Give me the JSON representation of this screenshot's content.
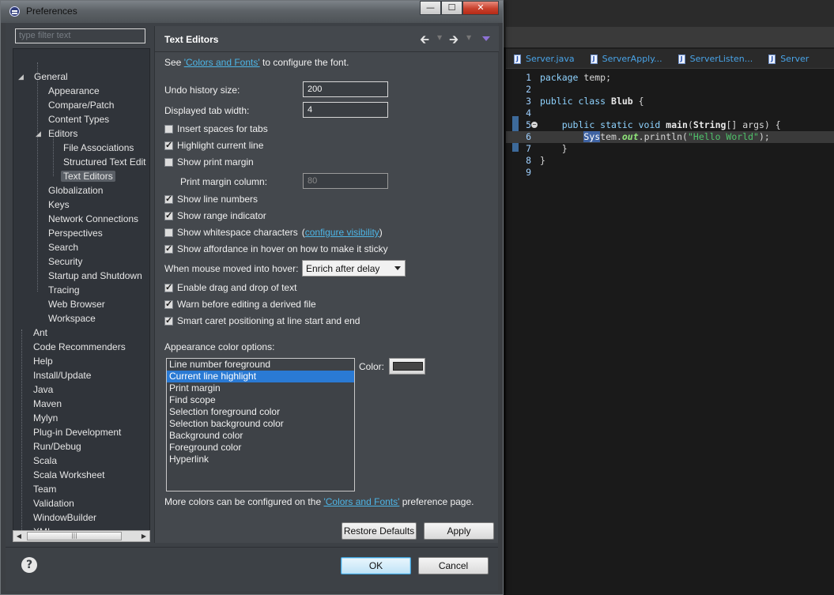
{
  "window": {
    "title": "Preferences",
    "minimize": "—",
    "maximize": "☐",
    "close": "✕"
  },
  "filter": {
    "placeholder": "type filter text"
  },
  "tree": [
    {
      "label": "General",
      "expanded": true
    },
    {
      "label": "Appearance"
    },
    {
      "label": "Compare/Patch"
    },
    {
      "label": "Content Types"
    },
    {
      "label": "Editors",
      "expanded": true
    },
    {
      "label": "File Associations"
    },
    {
      "label": "Structured Text Edit"
    },
    {
      "label": "Text Editors",
      "selected": true
    },
    {
      "label": "Globalization"
    },
    {
      "label": "Keys"
    },
    {
      "label": "Network Connections"
    },
    {
      "label": "Perspectives"
    },
    {
      "label": "Search"
    },
    {
      "label": "Security"
    },
    {
      "label": "Startup and Shutdown"
    },
    {
      "label": "Tracing"
    },
    {
      "label": "Web Browser"
    },
    {
      "label": "Workspace"
    },
    {
      "label": "Ant"
    },
    {
      "label": "Code Recommenders"
    },
    {
      "label": "Help"
    },
    {
      "label": "Install/Update"
    },
    {
      "label": "Java"
    },
    {
      "label": "Maven"
    },
    {
      "label": "Mylyn"
    },
    {
      "label": "Plug-in Development"
    },
    {
      "label": "Run/Debug"
    },
    {
      "label": "Scala"
    },
    {
      "label": "Scala Worksheet"
    },
    {
      "label": "Team"
    },
    {
      "label": "Validation"
    },
    {
      "label": "WindowBuilder"
    },
    {
      "label": "XML"
    }
  ],
  "page": {
    "title": "Text Editors",
    "see_prefix": "See ",
    "see_link": "'Colors and Fonts'",
    "see_suffix": " to configure the font.",
    "undo_label": "Undo history size:",
    "undo_value": "200",
    "tab_label": "Displayed tab width:",
    "tab_value": "4",
    "insert_spaces": {
      "label": "Insert spaces for tabs",
      "checked": false
    },
    "highlight_line": {
      "label": "Highlight current line",
      "checked": true
    },
    "print_margin": {
      "label": "Show print margin",
      "checked": false
    },
    "print_margin_col_label": "Print margin column:",
    "print_margin_col_value": "80",
    "line_numbers": {
      "label": "Show line numbers",
      "checked": true
    },
    "range_indicator": {
      "label": "Show range indicator",
      "checked": true
    },
    "whitespace": {
      "label": "Show whitespace characters",
      "checked": false,
      "paren_open": "(",
      "link": "configure visibility",
      "paren_close": ")"
    },
    "affordance": {
      "label": "Show affordance in hover on how to make it sticky",
      "checked": true
    },
    "hover_label": "When mouse moved into hover:",
    "hover_value": "Enrich after delay",
    "drag_drop": {
      "label": "Enable drag and drop of text",
      "checked": true
    },
    "warn_derived": {
      "label": "Warn before editing a derived file",
      "checked": true
    },
    "smart_caret": {
      "label": "Smart caret positioning at line start and end",
      "checked": true
    },
    "appearance_label": "Appearance color options:",
    "color_options": [
      "Line number foreground",
      "Current line highlight",
      "Print margin",
      "Find scope",
      "Selection foreground color",
      "Selection background color",
      "Background color",
      "Foreground color",
      "Hyperlink"
    ],
    "selected_color_option": "Current line highlight",
    "color_label": "Color:",
    "color_swatch": "#454545",
    "more_prefix": "More colors can be configured on the ",
    "more_link": "'Colors and Fonts'",
    "more_suffix": " preference page.",
    "restore_defaults": "Restore Defaults",
    "apply": "Apply"
  },
  "footer": {
    "help": "?",
    "ok": "OK",
    "cancel": "Cancel"
  },
  "editor": {
    "tabs": [
      "Server.java",
      "ServerApply...",
      "ServerListen...",
      "Server"
    ],
    "line_numbers": [
      "1",
      "2",
      "3",
      "4",
      "5",
      "6",
      "7",
      "8",
      "9"
    ]
  },
  "colors": {
    "link": "#4db5e6",
    "selection": "#2a7ad4",
    "dialog_bg": "#3d4146"
  }
}
